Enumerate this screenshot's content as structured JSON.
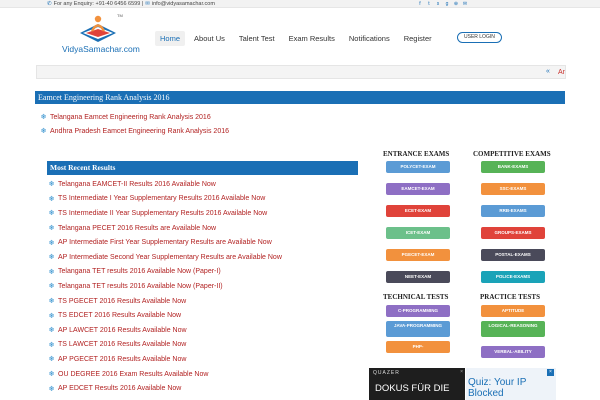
{
  "topbar": {
    "enquiry": "For any Enquiry: +91-40 6456 6599 |",
    "email": "info@vidyasamachar.com",
    "social_icons": [
      "facebook-icon",
      "twitter-icon",
      "skype-icon",
      "googleplus-icon",
      "skype-alt-icon",
      "email-icon"
    ]
  },
  "logo": {
    "text": "VidyaSamachar.com",
    "tm": "TM"
  },
  "nav": {
    "items": [
      "Home",
      "About Us",
      "Talent Test",
      "Exam Results",
      "Notifications",
      "Register"
    ],
    "login": "USER LOGIN"
  },
  "ticker": {
    "arrows": "«",
    "text": "An"
  },
  "eamcet": {
    "heading": "Eamcet Engineering Rank Analysis 2016",
    "links": [
      "Telangana Eamcet Engineering Rank Analysis 2016",
      "Andhra Pradesh Eamcet Engineering Rank Analysis 2016"
    ]
  },
  "recent": {
    "heading": "Most Recent Results",
    "links": [
      "Telangana EAMCET-II Results 2016 Available Now",
      "TS Intermediate I Year Supplementary Results 2016 Available Now",
      "TS Intermediate II Year Supplementary Results 2016 Available Now",
      "Telangana PECET 2016 Results are Available Now",
      "AP Intermediate First Year Supplementary Results are Available Now",
      "AP Intermediate Second Year Supplementary Results are Available Now",
      "Telangana TET results 2016 Available Now (Paper-I)",
      "Telangana TET results 2016 Available Now (Paper-II)",
      "TS PGECET 2016 Results Available Now",
      "TS EDCET 2016 Results Available Now",
      "AP LAWCET 2016 Results Available Now",
      "TS LAWCET 2016 Results Available Now",
      "AP PGECET 2016 Results Available Now",
      "OU DEGREE 2016 Exam Results Available Now",
      "AP EDCET Results 2016 Available Now"
    ]
  },
  "exams": {
    "entrance_head": "ENTRANCE EXAMS",
    "competitive_head": "COMPETITIVE EXAMS",
    "technical_head": "TECHNICAL TESTS",
    "practice_head": "PRACTICE TESTS",
    "entrance": [
      {
        "label": "POLYCET-EXAM",
        "color": "#5b9bd5"
      },
      {
        "label": "EAMCET-EXAM",
        "color": "#8e6fc4"
      },
      {
        "label": "ECET-EXAM",
        "color": "#e0433a"
      },
      {
        "label": "ICET-EXAM",
        "color": "#6cc08a"
      },
      {
        "label": "PGECET-EXAM",
        "color": "#f2913d"
      },
      {
        "label": "NEET-EXAM",
        "color": "#4a4a5a"
      }
    ],
    "competitive": [
      {
        "label": "BANK-EXAMS",
        "color": "#57b357"
      },
      {
        "label": "SSC-EXAMS",
        "color": "#f2913d"
      },
      {
        "label": "RRB-EXAMS",
        "color": "#5b9bd5"
      },
      {
        "label": "GROUPS-EXAMS",
        "color": "#e0433a"
      },
      {
        "label": "POSTAL-EXAMS",
        "color": "#4a4a5a"
      },
      {
        "label": "POLICE-EXAMS",
        "color": "#1aa3b8"
      }
    ],
    "technical": [
      {
        "label": "C-PROGRAMMING",
        "color": "#8e6fc4"
      },
      {
        "label": "JAVA-PROGRAMMING",
        "color": "#5b9bd5"
      },
      {
        "label": "PHP-",
        "color": "#f2913d"
      }
    ],
    "practice": [
      {
        "label": "APTITUDE",
        "color": "#f2913d"
      },
      {
        "label": "LOGICAL-REASONING",
        "color": "#57b357"
      },
      {
        "label": "VERBAL-ABILITY",
        "color": "#8e6fc4"
      }
    ]
  },
  "ads": {
    "ad1_brand": "QUAZER",
    "ad1_close": "×",
    "ad1_text": "DOKUS FÜR DIE",
    "ad2_text": "Quiz: Your IP Blocked",
    "ad2_close": "×"
  }
}
